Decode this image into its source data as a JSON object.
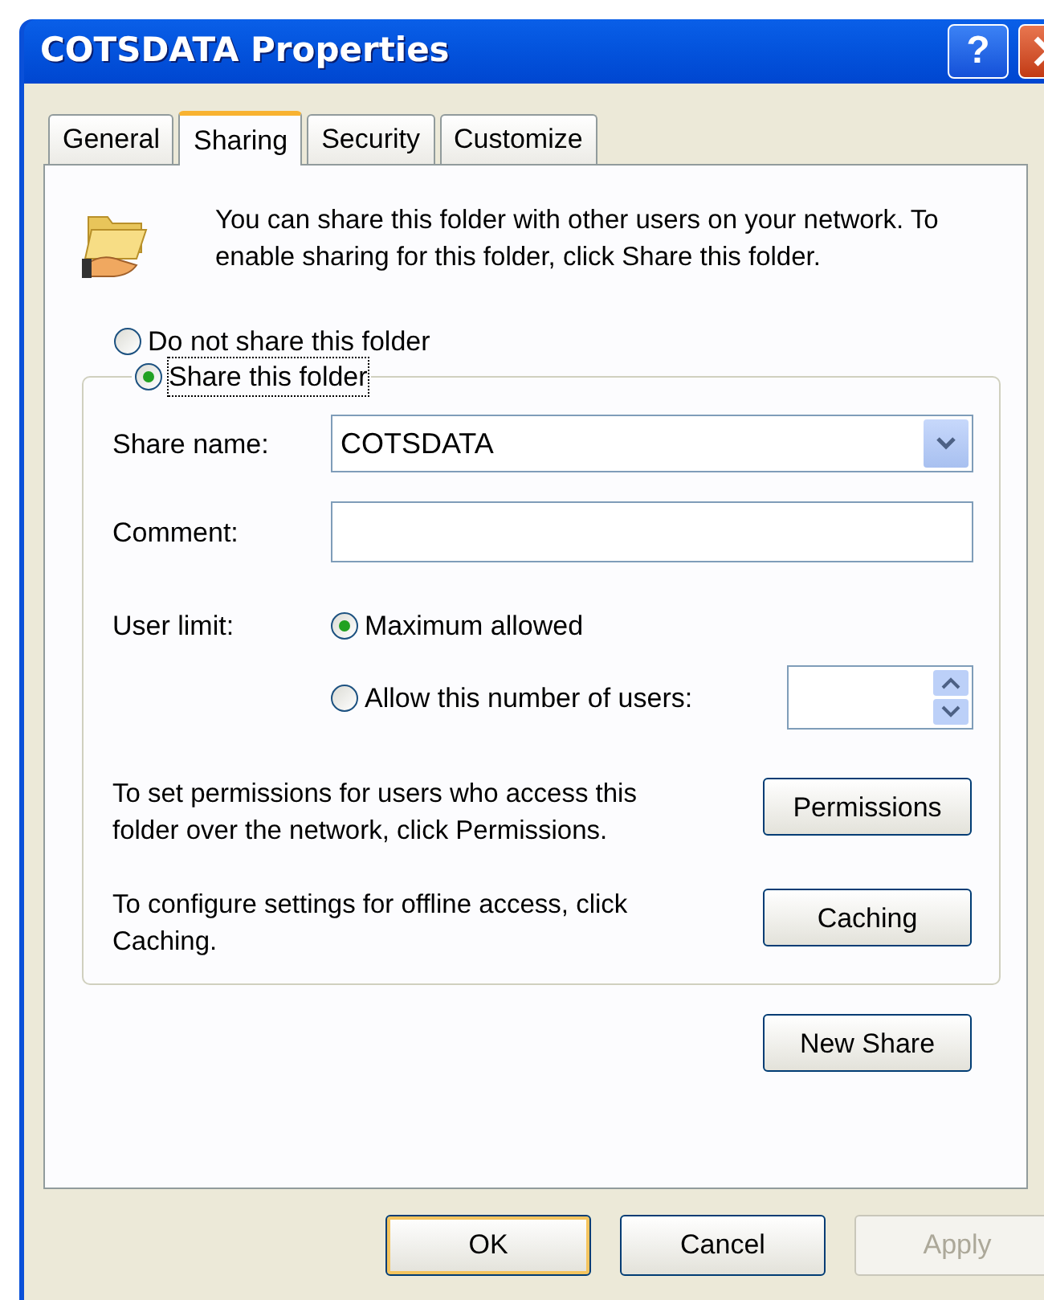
{
  "window": {
    "title": "COTSDATA Properties",
    "help_button": "?"
  },
  "tabs": [
    {
      "label": "General",
      "selected": false
    },
    {
      "label": "Sharing",
      "selected": true
    },
    {
      "label": "Security",
      "selected": false
    },
    {
      "label": "Customize",
      "selected": false
    }
  ],
  "description": "You can share this folder with other users on your network.  To enable sharing for this folder, click Share this folder.",
  "sharing_options": [
    {
      "label": "Do not share this folder",
      "selected": false
    },
    {
      "label": "Share this folder",
      "selected": true
    }
  ],
  "share_name": {
    "label": "Share name:",
    "value": "COTSDATA"
  },
  "comment": {
    "label": "Comment:"
  },
  "user_limit": {
    "label": "User limit:",
    "options": [
      {
        "label": "Maximum allowed",
        "selected": true
      },
      {
        "label": "Allow this number of users:",
        "selected": false
      }
    ]
  },
  "permissions": {
    "text": "To set permissions for users who access this folder over the network, click Permissions.",
    "button": "Permissions"
  },
  "caching": {
    "text": "To configure settings for offline access, click Caching.",
    "button": "Caching"
  },
  "new_share_button": "New Share",
  "dialog_buttons": [
    {
      "label": "OK",
      "default": true,
      "disabled": false
    },
    {
      "label": "Cancel",
      "default": false,
      "disabled": false
    },
    {
      "label": "Apply",
      "default": false,
      "disabled": true
    }
  ]
}
